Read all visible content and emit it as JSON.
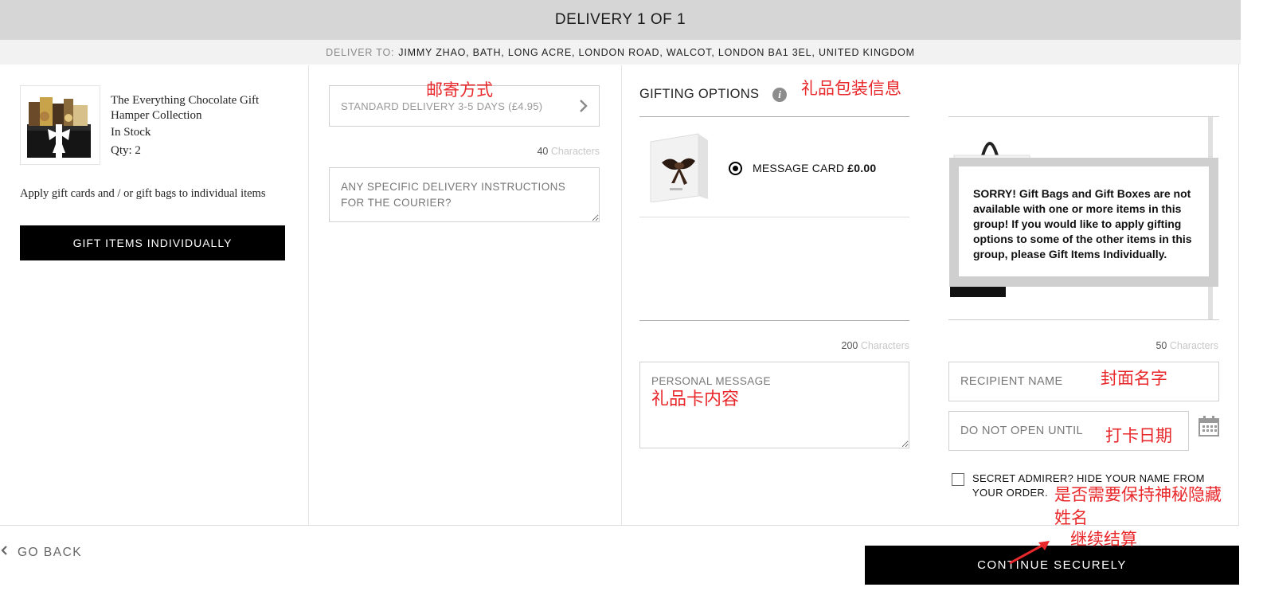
{
  "header": {
    "title": "DELIVERY 1 OF 1"
  },
  "deliver_to": {
    "label": "DELIVER TO:",
    "address": "JIMMY ZHAO, BATH, LONG ACRE, LONDON ROAD, WALCOT, LONDON BA1 3EL, UNITED KINGDOM"
  },
  "product": {
    "name": "The Everything Chocolate Gift Hamper Collection",
    "stock": "In Stock",
    "qty": "Qty: 2"
  },
  "apply_text": "Apply gift cards and / or gift bags to individual items",
  "gift_individually_label": "GIFT ITEMS INDIVIDUALLY",
  "delivery": {
    "method": "STANDARD DELIVERY 3-5 DAYS (£4.95)",
    "instructions_count": "40",
    "characters_label": "Characters",
    "instructions_placeholder": "ANY SPECIFIC DELIVERY INSTRUCTIONS FOR THE COURIER?"
  },
  "gifting": {
    "title": "GIFTING OPTIONS",
    "info_glyph": "i",
    "card_label": "MESSAGE CARD",
    "card_price": "£0.00",
    "message_count": "200",
    "message_placeholder": "PERSONAL MESSAGE"
  },
  "gift_bags": {
    "sorry_text": "SORRY! Gift Bags and Gift Boxes are not available with one or more items in this group! If you would like to apply gifting options to some of the other items in this group, please Gift Items Individually.",
    "name_count": "50",
    "recipient_placeholder": "RECIPIENT NAME",
    "date_placeholder": "DO NOT OPEN UNTIL",
    "secret_label": "SECRET ADMIRER? HIDE YOUR NAME FROM YOUR ORDER."
  },
  "footer": {
    "go_back": "GO BACK",
    "continue": "CONTINUE SECURELY"
  },
  "annotations": {
    "delivery_method": "邮寄方式",
    "gift_wrap_info": "礼品包装信息",
    "card_content": "礼品卡内容",
    "cover_name": "封面名字",
    "card_date": "打卡日期",
    "keep_secret_line1": "是否需要保持神秘隐藏",
    "keep_secret_line2": "姓名",
    "continue_checkout": "继续结算"
  },
  "colors": {
    "annotation": "#e8282b",
    "button_bg": "#000000",
    "header_bg": "#d6d6d6"
  }
}
